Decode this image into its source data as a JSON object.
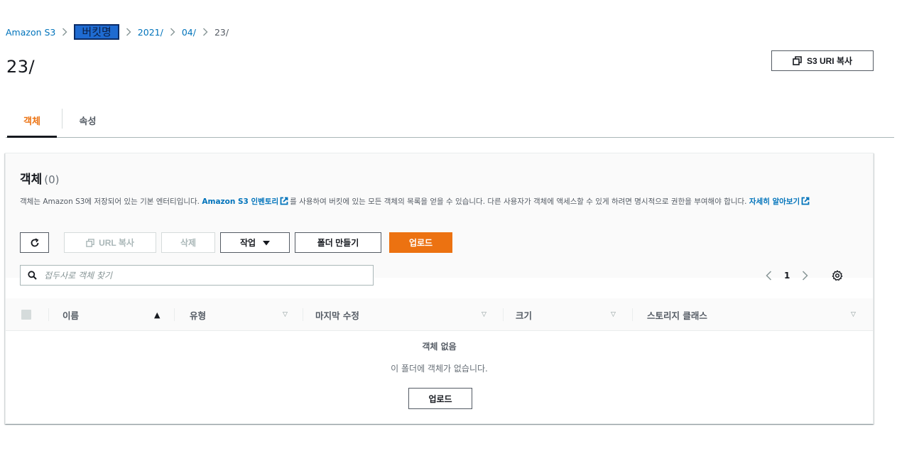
{
  "breadcrumb": {
    "root": "Amazon S3",
    "bucket": "버킷명",
    "path": [
      "2021/",
      "04/",
      "23/"
    ]
  },
  "page": {
    "title": "23/",
    "copy_uri_label": "S3 URI 복사"
  },
  "tabs": [
    {
      "label": "객체",
      "active": true
    },
    {
      "label": "속성",
      "active": false
    }
  ],
  "objects": {
    "title": "객체",
    "count": "(0)",
    "description_1": "객체는 Amazon S3에 저장되어 있는 기본 엔터티입니다. ",
    "inventory_link": "Amazon S3 인벤토리",
    "description_2": "를 사용하여 버킷에 있는 모든 객체의 목록을 얻을 수 있습니다. 다른 사용자가 객체에 액세스할 수 있게 하려면 명시적으로 권한을 부여해야 합니다. ",
    "learn_more_link": "자세히 알아보기"
  },
  "toolbar": {
    "url_copy": "URL 복사",
    "delete": "삭제",
    "actions": "작업",
    "create_folder": "폴더 만들기",
    "upload": "업로드"
  },
  "search": {
    "placeholder": "접두사로 객체 찾기"
  },
  "pagination": {
    "current_page": "1"
  },
  "table": {
    "columns": [
      "이름",
      "유형",
      "마지막 수정",
      "크기",
      "스토리지 클래스"
    ],
    "empty_title": "객체 없음",
    "empty_description": "이 폴더에 객체가 없습니다.",
    "empty_upload": "업로드"
  },
  "colors": {
    "accent": "#ec7211",
    "link": "#0073bb",
    "bucket_highlight": "#1f6bd1"
  }
}
